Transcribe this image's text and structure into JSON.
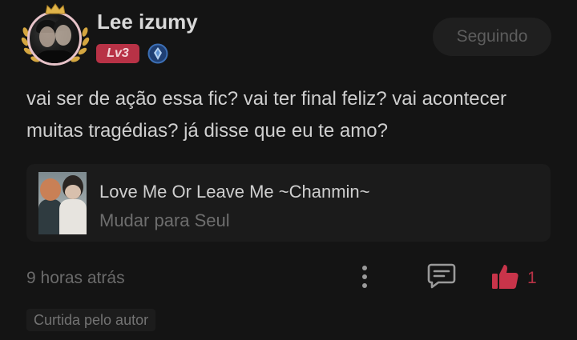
{
  "header": {
    "username": "Lee izumy",
    "level_badge": "Lv3",
    "follow_button_label": "Seguindo",
    "icons": {
      "avatar": "profile-picture-frame",
      "crown": "crown-icon",
      "laurel": "laurel-wreath-icon",
      "rank": "blue-diamond-rank-icon"
    }
  },
  "comment": {
    "text": "vai ser de ação essa fic? vai ter final feliz? vai acontecer muitas tragédias? já disse que eu te amo?"
  },
  "story_card": {
    "title": "Love Me Or Leave Me ~Chanmin~",
    "subtitle": "Mudar para Seul"
  },
  "footer": {
    "timestamp": "9 horas atrás",
    "like_count": "1",
    "author_liked_label": "Curtida pelo autor",
    "icons": {
      "more": "more-vertical-icon",
      "reply": "reply-bubble-icon",
      "like": "thumbs-up-icon"
    }
  },
  "colors": {
    "background": "#141414",
    "accent": "#b83246",
    "text": "#d9d9d9",
    "muted": "#6b6b6b",
    "card": "#1b1b1b"
  }
}
